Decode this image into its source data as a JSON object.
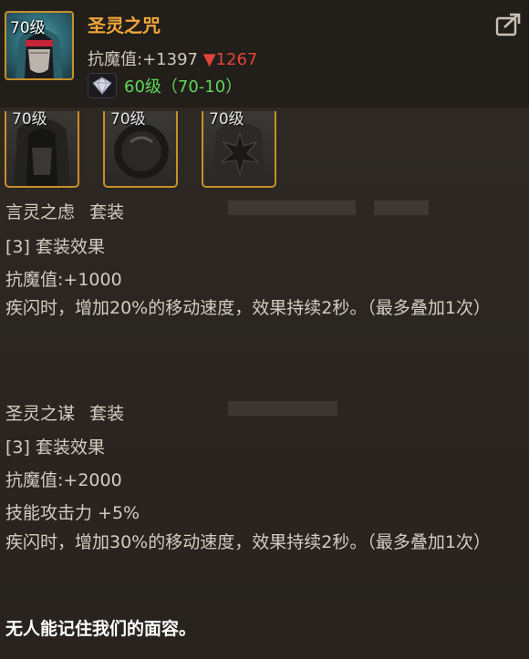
{
  "item": {
    "level_badge": "70级",
    "name": "圣灵之咒",
    "stat_label": "抗魔值:",
    "stat_value": "+1397",
    "stat_down_arrow": "▼",
    "stat_down_value": "1267",
    "gem_text": "60级（70-10）",
    "icon_names": [
      "item-mask-icon",
      "gem-icon",
      "share-icon"
    ]
  },
  "set_pieces": [
    {
      "level": "70级"
    },
    {
      "level": "70级"
    },
    {
      "level": "70级"
    }
  ],
  "set1": {
    "name": "言灵之虑",
    "tag": "套装",
    "effect_header": "[3] 套装效果",
    "stat": "抗魔值:+1000",
    "description": "疾闪时，增加20%的移动速度，效果持续2秒。（最多叠加1次）"
  },
  "set2": {
    "name": "圣灵之谋",
    "tag": "套装",
    "effect_header": "[3] 套装效果",
    "stat": "抗魔值:+2000",
    "stat2": "技能攻击力 +5%",
    "description": "疾闪时，增加30%的移动速度，效果持续2秒。（最多叠加1次）"
  },
  "flavor_text": "无人能记住我们的面容。",
  "colors": {
    "title": "#f0a63a",
    "frame": "#c8902a",
    "down": "#e0443a",
    "gem": "#5fd65a"
  }
}
